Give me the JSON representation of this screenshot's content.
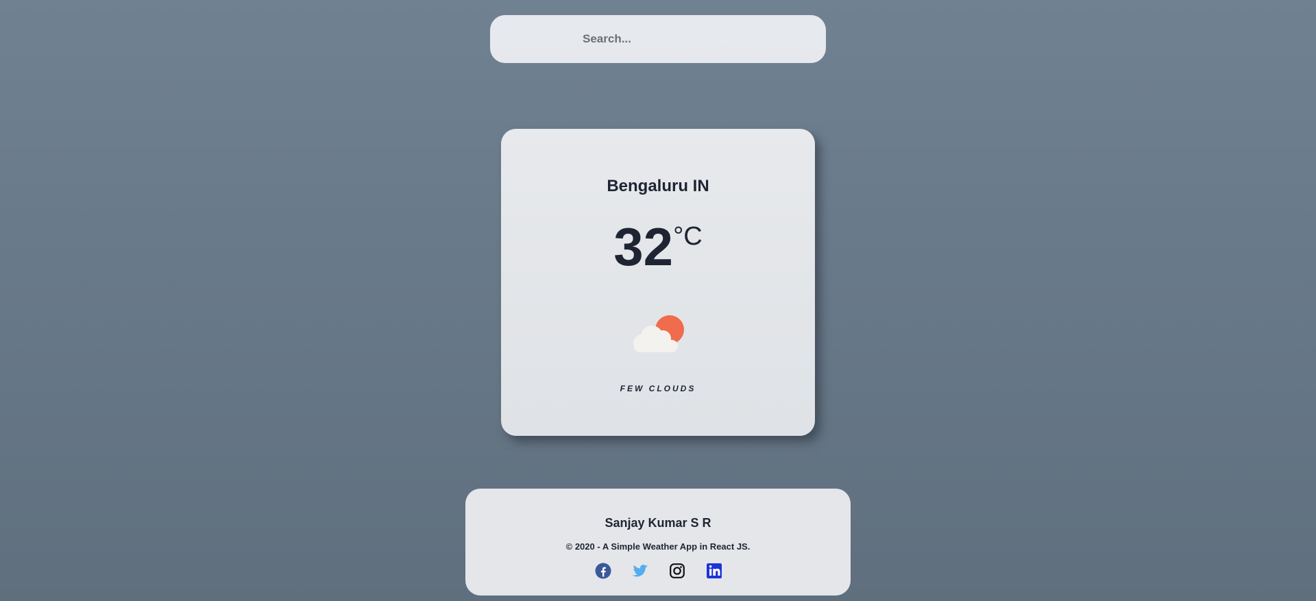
{
  "search": {
    "placeholder": "Search...",
    "value": ""
  },
  "weather": {
    "city": "Bengaluru IN",
    "temperature": "32",
    "unit": "°C",
    "icon": "few-clouds-day-icon",
    "description": "Few Clouds"
  },
  "footer": {
    "author": "Sanjay Kumar S R",
    "copyright": "© 2020 - A Simple Weather App in React JS.",
    "social": [
      {
        "name": "facebook-icon",
        "color": "#3b5998"
      },
      {
        "name": "twitter-icon",
        "color": "#55acee"
      },
      {
        "name": "instagram-icon",
        "color": "#111111"
      },
      {
        "name": "linkedin-icon",
        "color": "#1d33d8"
      }
    ]
  },
  "colors": {
    "background_top": "#708192",
    "background_bottom": "#5f6f7e",
    "card": "#e4e6e9",
    "text": "#1f2433",
    "sun": "#ef6c4c",
    "cloud": "#f3f2ef"
  }
}
